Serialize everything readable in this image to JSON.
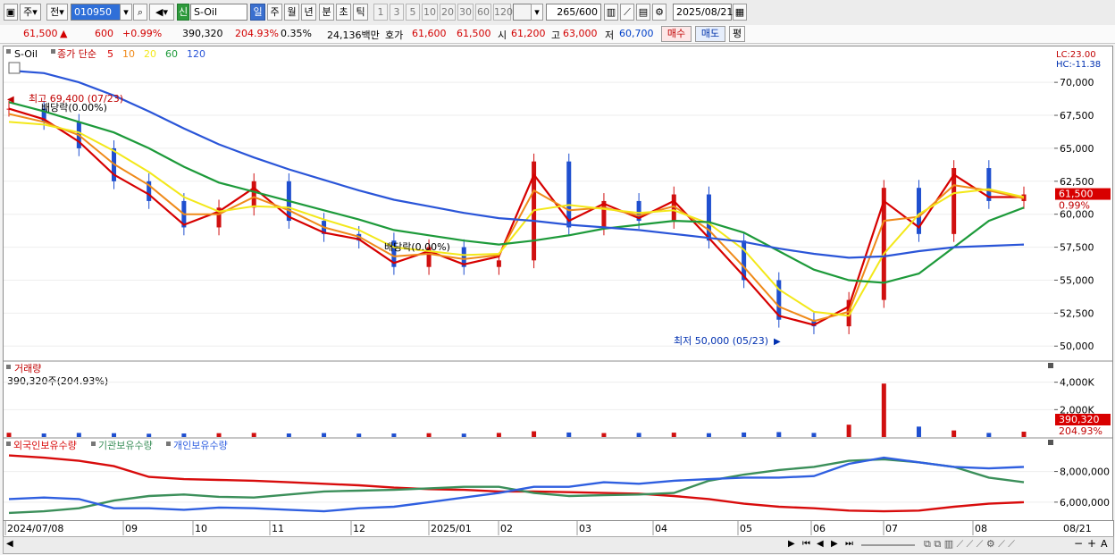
{
  "toolbar": {
    "market_btn": "주",
    "prev_btn": "전",
    "code": "010950",
    "sound_btn": "◀",
    "sin_badge": "신",
    "stock_name": "S-Oil",
    "periods": [
      "일",
      "주",
      "월",
      "년",
      "분",
      "초",
      "틱"
    ],
    "intervals": [
      "1",
      "3",
      "5",
      "10",
      "20",
      "30",
      "60",
      "120"
    ],
    "count": "265",
    "count_max": "/600",
    "date": "2025/08/21"
  },
  "infobar": {
    "price": "61,500",
    "change_arrow": "▲",
    "change": "600",
    "change_pct": "+0.99%",
    "volume": "390,320",
    "volume_pct": "204.93%",
    "turnover": "0.35%",
    "amount": "24,136백만",
    "bid_label": "호가",
    "bid1": "61,600",
    "bid2": "61,500",
    "open_label": "시",
    "open": "61,200",
    "high_label": "고",
    "high": "63,000",
    "low_label": "저",
    "low": "60,700",
    "buy_btn": "매수",
    "sell_btn": "매도",
    "eval_btn": "평"
  },
  "price_panel": {
    "name": "S-Oil",
    "ma_label": "종가 단순",
    "ma_periods": [
      "5",
      "10",
      "20",
      "60",
      "120"
    ],
    "high_note": "최고 69,400 (07/23)",
    "ex_div_note1": "배당락(0.00%)",
    "ex_div_note2": "배당락(0.00%)",
    "low_note": "최저 50,000 (05/23)",
    "lc": "LC:23.00",
    "hc": "HC:-11.38",
    "price_tag": "61,500",
    "pct_tag": "0.99%",
    "y_ticks": [
      "70,000",
      "67,500",
      "65,000",
      "62,500",
      "60,000",
      "57,500",
      "55,000",
      "52,500",
      "50,000"
    ]
  },
  "volume_panel": {
    "title": "거래량",
    "value": "390,320주(204.93%)",
    "y_ticks": [
      "4,000K",
      "2,000K"
    ],
    "tag": "390,320",
    "tag_pct": "204.93%"
  },
  "holdings_panel": {
    "legend": [
      "외국인보유수량",
      "기관보유수량",
      "개인보유수량"
    ],
    "y_ticks": [
      "8,000,000",
      "6,000,000"
    ]
  },
  "xaxis": {
    "labels": [
      "2024/07/08",
      "09",
      "10",
      "11",
      "12",
      "2025/01",
      "02",
      "03",
      "04",
      "05",
      "06",
      "07",
      "08"
    ],
    "right_label": "08/21"
  },
  "colors": {
    "ma5": "#d60000",
    "ma10": "#ef8a1a",
    "ma20": "#f3e81a",
    "ma60": "#1d9a3a",
    "ma120": "#2a55d8",
    "up": "#d01010",
    "down": "#1f4fcf",
    "foreign": "#d80c0c",
    "institution": "#3b8f5a",
    "individual": "#2f5fe0"
  },
  "chart_data": [
    {
      "type": "candlestick",
      "title": "S-Oil",
      "ylim": [
        49000,
        71500
      ],
      "x": [
        "2024/07/08",
        "07/22",
        "08/05",
        "08/19",
        "09/02",
        "09/16",
        "09/30",
        "10/14",
        "10/28",
        "11/11",
        "11/25",
        "12/09",
        "12/23",
        "2025/01/06",
        "01/20",
        "02/03",
        "02/17",
        "03/03",
        "03/17",
        "03/31",
        "04/14",
        "04/28",
        "05/12",
        "05/26",
        "06/09",
        "06/23",
        "07/07",
        "07/21",
        "08/04",
        "08/21"
      ],
      "series": [
        {
          "name": "종가",
          "values": [
            68000,
            67000,
            65000,
            62500,
            61000,
            59000,
            60500,
            62500,
            59500,
            58500,
            58000,
            56000,
            57500,
            56000,
            56500,
            64000,
            59000,
            61000,
            59500,
            61500,
            58000,
            55000,
            52000,
            51500,
            53500,
            62000,
            58500,
            63500,
            61000,
            61500
          ]
        },
        {
          "name": "5",
          "values": [
            68000,
            67200,
            65500,
            63000,
            61500,
            59200,
            60200,
            62000,
            59800,
            58600,
            58100,
            56300,
            57200,
            56200,
            56800,
            63000,
            59500,
            60800,
            59700,
            61000,
            58200,
            55300,
            52300,
            51600,
            53000,
            61000,
            59000,
            63000,
            61300,
            61300
          ]
        },
        {
          "name": "10",
          "values": [
            67600,
            67000,
            66000,
            63800,
            62200,
            60000,
            60000,
            61300,
            60300,
            59000,
            58300,
            56800,
            57000,
            56600,
            56900,
            61800,
            60300,
            60500,
            59900,
            60600,
            58800,
            56000,
            53000,
            51900,
            52600,
            59500,
            59800,
            62200,
            61800,
            61200
          ]
        },
        {
          "name": "20",
          "values": [
            67000,
            66800,
            66200,
            64800,
            63200,
            61300,
            60200,
            60600,
            60500,
            59600,
            58800,
            57500,
            57200,
            56900,
            57000,
            60300,
            60700,
            60400,
            60100,
            60300,
            59300,
            57300,
            54300,
            52600,
            52300,
            57000,
            60000,
            61600,
            61900,
            61300
          ]
        },
        {
          "name": "60",
          "values": [
            68500,
            67800,
            67000,
            66200,
            65000,
            63600,
            62400,
            61700,
            61000,
            60300,
            59600,
            58800,
            58400,
            58000,
            57700,
            58000,
            58400,
            58900,
            59200,
            59500,
            59400,
            58600,
            57200,
            55800,
            55000,
            54800,
            55500,
            57500,
            59500,
            60500
          ]
        },
        {
          "name": "120",
          "values": [
            70900,
            70700,
            70000,
            69000,
            67800,
            66500,
            65300,
            64300,
            63400,
            62600,
            61800,
            61100,
            60600,
            60100,
            59700,
            59500,
            59200,
            59000,
            58800,
            58500,
            58200,
            57900,
            57400,
            57000,
            56700,
            56800,
            57200,
            57500,
            57600,
            57700
          ]
        }
      ]
    },
    {
      "type": "bar",
      "title": "거래량",
      "x": [
        "2024/07/08",
        "07/22",
        "08/05",
        "08/19",
        "09/02",
        "09/16",
        "09/30",
        "10/14",
        "10/28",
        "11/11",
        "11/25",
        "12/09",
        "12/23",
        "2025/01/06",
        "01/20",
        "02/03",
        "02/17",
        "03/03",
        "03/17",
        "03/31",
        "04/14",
        "04/28",
        "05/12",
        "05/26",
        "06/09",
        "06/23",
        "07/07",
        "07/21",
        "08/04",
        "08/21"
      ],
      "values": [
        310000,
        260000,
        300000,
        280000,
        240000,
        260000,
        280000,
        300000,
        260000,
        290000,
        250000,
        260000,
        280000,
        250000,
        300000,
        420000,
        330000,
        290000,
        300000,
        320000,
        280000,
        330000,
        360000,
        300000,
        900000,
        3900000,
        760000,
        480000,
        300000,
        390320
      ],
      "ylim": [
        0,
        4500000
      ]
    },
    {
      "type": "line",
      "title": "보유수량",
      "x": [
        "2024/07/08",
        "07/22",
        "08/05",
        "08/19",
        "09/02",
        "09/16",
        "09/30",
        "10/14",
        "10/28",
        "11/11",
        "11/25",
        "12/09",
        "12/23",
        "2025/01/06",
        "01/20",
        "02/03",
        "02/17",
        "03/03",
        "03/17",
        "03/31",
        "04/14",
        "04/28",
        "05/12",
        "05/26",
        "06/09",
        "06/23",
        "07/07",
        "07/21",
        "08/04",
        "08/21"
      ],
      "ylim": [
        5000000,
        9200000
      ],
      "series": [
        {
          "name": "외국인보유수량",
          "values": [
            9050000,
            8900000,
            8700000,
            8350000,
            7650000,
            7500000,
            7450000,
            7400000,
            7300000,
            7200000,
            7100000,
            6950000,
            6850000,
            6800000,
            6700000,
            6700000,
            6650000,
            6600000,
            6550000,
            6400000,
            6200000,
            5900000,
            5700000,
            5600000,
            5450000,
            5400000,
            5450000,
            5700000,
            5900000,
            6000000
          ]
        },
        {
          "name": "기관보유수량",
          "values": [
            5300000,
            5400000,
            5600000,
            6100000,
            6400000,
            6500000,
            6350000,
            6300000,
            6500000,
            6700000,
            6750000,
            6800000,
            6900000,
            7000000,
            7000000,
            6600000,
            6400000,
            6450000,
            6500000,
            6600000,
            7400000,
            7800000,
            8100000,
            8300000,
            8700000,
            8800000,
            8600000,
            8300000,
            7600000,
            7300000
          ]
        },
        {
          "name": "개인보유수량",
          "values": [
            6200000,
            6300000,
            6200000,
            5600000,
            5600000,
            5500000,
            5650000,
            5600000,
            5500000,
            5400000,
            5600000,
            5700000,
            6000000,
            6300000,
            6600000,
            7000000,
            7000000,
            7300000,
            7200000,
            7400000,
            7500000,
            7600000,
            7600000,
            7700000,
            8500000,
            8900000,
            8600000,
            8300000,
            8200000,
            8300000
          ]
        }
      ]
    }
  ]
}
